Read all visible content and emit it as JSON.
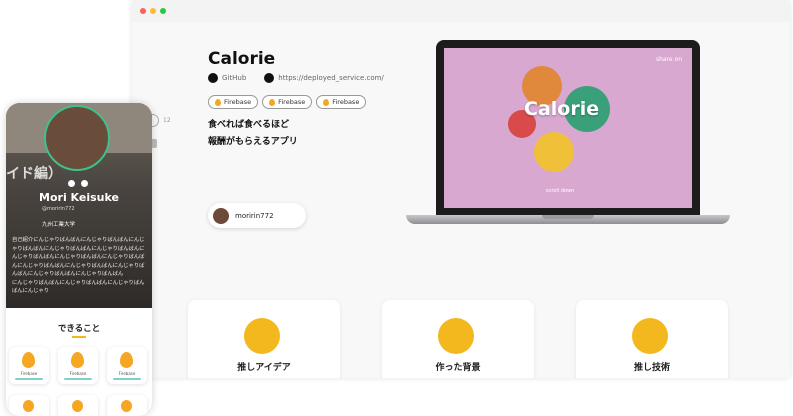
{
  "desktop": {
    "title": "Calorie",
    "links": {
      "github": "GitHub",
      "deployed": "https://deployed_service.com/"
    },
    "tags": [
      "Firebase",
      "Firebase",
      "Firebase"
    ],
    "description": [
      "食べれば食べるほど",
      "報酬がもらえるアプリ"
    ],
    "side_indicator": "12",
    "author": "moririn772",
    "screen": {
      "app_name": "Calorie",
      "share": "share on",
      "scroll": "scroll down",
      "brand_color": "#d8a8d0"
    },
    "cards": [
      "推しアイデア",
      "作った背景",
      "推し技術"
    ]
  },
  "phone": {
    "bg_overlay_text": "イド編）",
    "name": "Mori Keisuke",
    "handle": "@moririn772",
    "university": "九州工業大学",
    "bio": "自己紹介にんじゃりばんばんにんじゃりばんばんにんじゃりばんばんにんじゃりばんばんにんじゃりばんばんにんじゃりばんばんにんじゃりばんばんにんじゃりばんばんにんじゃりばんばんにんじゃりばんばんにんじゃりばんばんにんじゃりばんばんにんじゃりばんばん",
    "bio_tail": "にんじゃりばんばんにんじゃりばんばんにんじゃりばんばんにんじゃり",
    "section_title": "できること",
    "skills": [
      "Firebase",
      "Firebase",
      "Firebase"
    ],
    "accent": "#3cc28a",
    "section_accent": "#f2b81d"
  }
}
